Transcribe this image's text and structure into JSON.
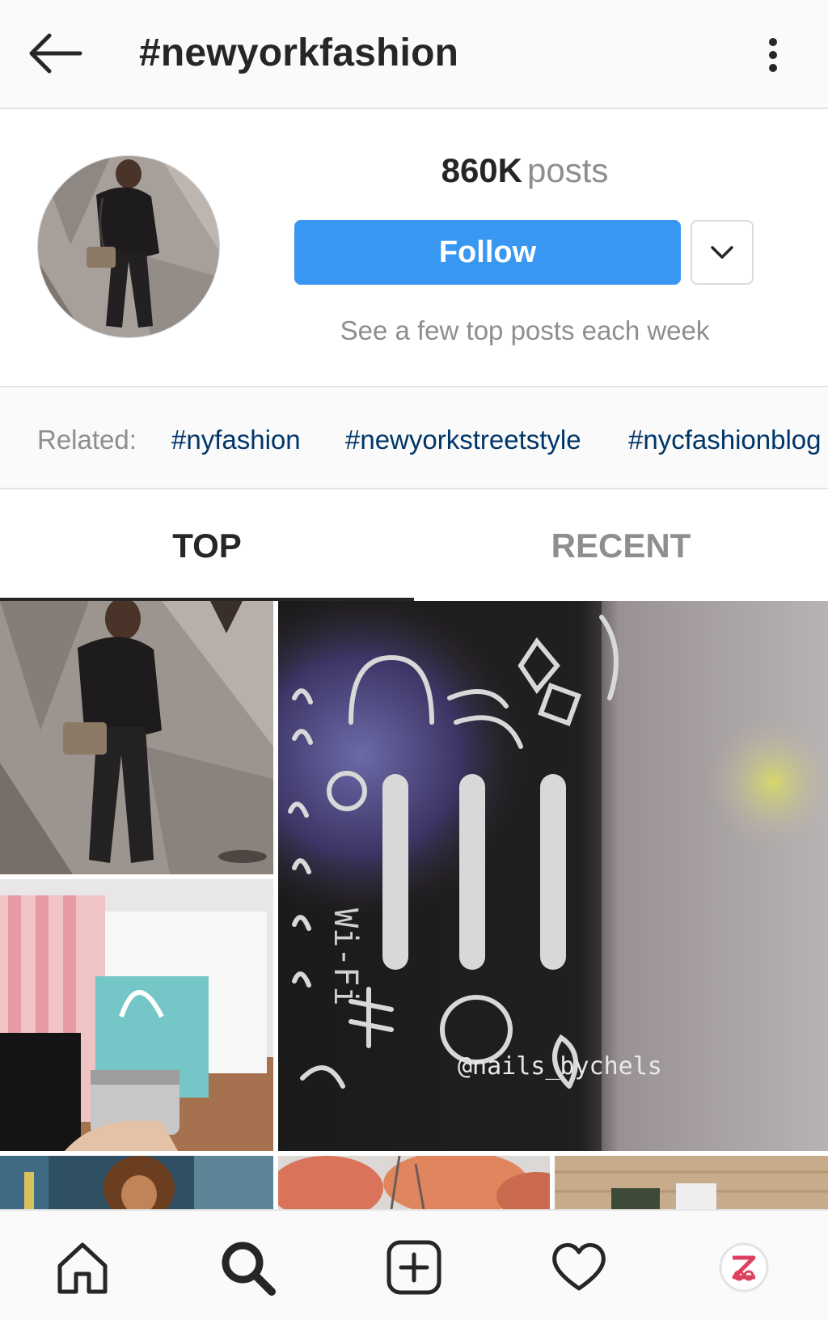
{
  "topbar": {
    "title": "#newyorkfashion",
    "back_icon": "arrow-left-icon",
    "menu_icon": "more-vertical-icon"
  },
  "header": {
    "posts_count": "860K",
    "posts_label": "posts",
    "follow_label": "Follow",
    "follow_hint": "See a few top posts each week",
    "dropdown_icon": "chevron-down-icon",
    "accent_color": "#3897f0"
  },
  "related": {
    "label": "Related:",
    "tags": [
      "#nyfashion",
      "#newyorkstreetstyle",
      "#nycfashionblog"
    ],
    "tag_color": "#003569"
  },
  "tabs": [
    {
      "label": "TOP",
      "active": true
    },
    {
      "label": "RECENT",
      "active": false
    }
  ],
  "grid": {
    "posts": [
      {
        "description": "woman in black puffer jacket"
      },
      {
        "description": "nail stamping plate video"
      },
      {
        "description": "shopping bags and glamglow jar"
      },
      {
        "description": "woman with curly hair"
      },
      {
        "description": "autumn trees"
      },
      {
        "description": "wooden table"
      }
    ],
    "watermark": "@nails_bychels"
  },
  "bottom_nav": [
    {
      "icon": "home-icon"
    },
    {
      "icon": "search-icon"
    },
    {
      "icon": "add-post-icon"
    },
    {
      "icon": "heart-icon"
    },
    {
      "icon": "profile-avatar-icon"
    }
  ]
}
